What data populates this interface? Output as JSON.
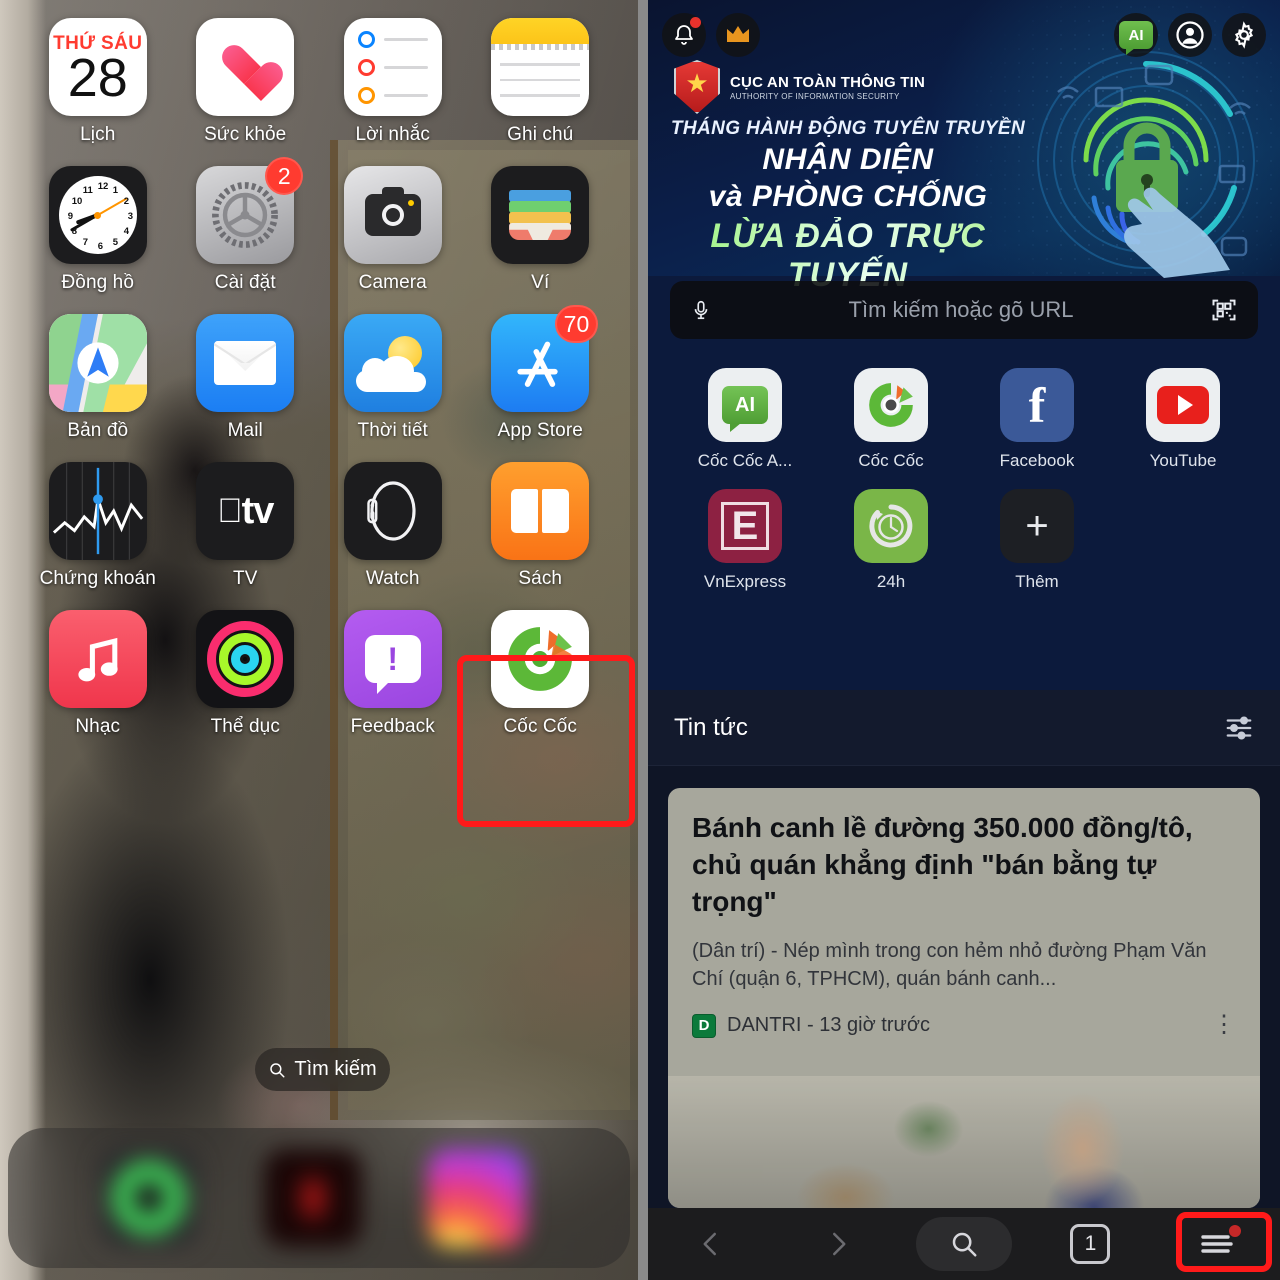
{
  "left_phone": {
    "apps": [
      {
        "name": "Lịch",
        "icon": "calendar-icon",
        "weekday": "THỨ SÁU",
        "day": "28",
        "badge": null
      },
      {
        "name": "Sức khỏe",
        "icon": "health-heart-icon",
        "badge": null
      },
      {
        "name": "Lời nhắc",
        "icon": "reminders-icon",
        "badge": null
      },
      {
        "name": "Ghi chú",
        "icon": "notes-icon",
        "badge": null
      },
      {
        "name": "Đồng hồ",
        "icon": "clock-icon",
        "badge": null
      },
      {
        "name": "Cài đặt",
        "icon": "settings-gear-icon",
        "badge": "2"
      },
      {
        "name": "Camera",
        "icon": "camera-icon",
        "badge": null
      },
      {
        "name": "Ví",
        "icon": "wallet-icon",
        "badge": null
      },
      {
        "name": "Bản đồ",
        "icon": "maps-icon",
        "badge": null
      },
      {
        "name": "Mail",
        "icon": "mail-envelope-icon",
        "badge": null
      },
      {
        "name": "Thời tiết",
        "icon": "weather-icon",
        "badge": null
      },
      {
        "name": "App Store",
        "icon": "app-store-icon",
        "badge": "70"
      },
      {
        "name": "Chứng khoán",
        "icon": "stocks-icon",
        "badge": null
      },
      {
        "name": "TV",
        "icon": "apple-tv-icon",
        "badge": null
      },
      {
        "name": "Watch",
        "icon": "watch-icon",
        "badge": null
      },
      {
        "name": "Sách",
        "icon": "books-icon",
        "badge": null
      },
      {
        "name": "Nhạc",
        "icon": "music-note-icon",
        "badge": null
      },
      {
        "name": "Thể dục",
        "icon": "fitness-rings-icon",
        "badge": null
      },
      {
        "name": "Feedback",
        "icon": "feedback-bubble-icon",
        "badge": null
      },
      {
        "name": "Cốc Cốc",
        "icon": "coccoc-icon",
        "badge": null,
        "highlighted": true
      }
    ],
    "clock_numbers": [
      "12",
      "1",
      "2",
      "3",
      "4",
      "5",
      "6",
      "7",
      "8",
      "9",
      "10",
      "11"
    ],
    "search_pill": {
      "label": "Tìm kiếm",
      "icon": "search-icon"
    },
    "dock": [
      {
        "name": "dock-app-green",
        "color": "#3fd05a"
      },
      {
        "name": "dock-app-red",
        "color": "#e21b1b"
      },
      {
        "name": "dock-app-instagram",
        "color": "#e8397f"
      }
    ],
    "highlight_color": "#ff1a1a",
    "feedback_glyph": "!",
    "tv_label": "tv"
  },
  "right_phone": {
    "top_icons": {
      "bell": "notification-bell-icon",
      "crown": "premium-crown-icon",
      "ai_label": "AI",
      "account": "account-avatar-icon",
      "settings": "settings-gear-icon"
    },
    "banner": {
      "org_name": "CỤC AN TOÀN THÔNG TIN",
      "org_sub": "AUTHORITY OF INFORMATION SECURITY",
      "line1": "THÁNG HÀNH ĐỘNG TUYÊN TRUYỀN",
      "line2": "NHẬN DIỆN",
      "line3": "và PHÒNG CHỐNG",
      "line4": "LỪA ĐẢO TRỰC TUYẾN"
    },
    "search": {
      "placeholder": "Tìm kiếm hoặc gõ URL",
      "mic": "microphone-icon",
      "qr": "qr-scanner-icon"
    },
    "shortcuts": [
      {
        "label": "Cốc Cốc A...",
        "icon": "coccoc-ai-icon",
        "glyph": "AI"
      },
      {
        "label": "Cốc Cốc",
        "icon": "coccoc-icon"
      },
      {
        "label": "Facebook",
        "icon": "facebook-icon",
        "glyph": "f"
      },
      {
        "label": "YouTube",
        "icon": "youtube-icon"
      },
      {
        "label": "VnExpress",
        "icon": "vnexpress-icon",
        "glyph": "E"
      },
      {
        "label": "24h",
        "icon": "24h-clock-icon"
      },
      {
        "label": "Thêm",
        "icon": "add-plus-icon",
        "glyph": "+"
      }
    ],
    "news": {
      "section_title": "Tin tức",
      "filter_icon": "sliders-filter-icon",
      "article": {
        "title": "Bánh canh lề đường 350.000 đồng/tô, chủ quán khẳng định \"bán bằng tự trọng\"",
        "summary": "(Dân trí) - Nép mình trong con hẻm nhỏ đường Phạm Văn Chí (quận 6, TPHCM), quán bánh canh...",
        "source": "DANTRI",
        "source_initial": "D",
        "time": "13 giờ trước",
        "meta_line": "DANTRI - 13 giờ trước",
        "more_icon": "kebab-menu-icon"
      }
    },
    "bottom_bar": {
      "back": "back-chevron-icon",
      "forward": "forward-chevron-icon",
      "search": "search-icon",
      "tab_count": "1",
      "menu": "hamburger-menu-icon",
      "menu_highlighted": true
    },
    "highlight_color": "#ff1a1a"
  }
}
